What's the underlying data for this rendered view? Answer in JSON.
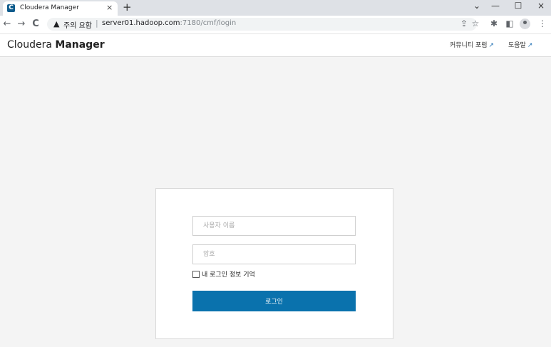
{
  "browser": {
    "tab": {
      "favicon_letter": "C",
      "title": "Cloudera Manager",
      "close_glyph": "×"
    },
    "new_tab_glyph": "+",
    "window_controls": {
      "tab_search": "⌄",
      "minimize": "—",
      "maximize": "☐",
      "close": "×"
    },
    "nav": {
      "back": "←",
      "forward": "→",
      "reload": "C"
    },
    "address": {
      "security_icon": "warning-triangle-icon",
      "security_glyph": "▲",
      "security_text": "주의 요함",
      "separator": "|",
      "url_host": "server01.hadoop.com",
      "url_path": ":7180/cmf/login"
    },
    "toolbar": {
      "share": "⇪",
      "bookmark": "☆",
      "extensions": "✱",
      "sidepanel": "◧",
      "menu": "⋮"
    }
  },
  "header": {
    "brand_light": "Cloudera ",
    "brand_bold": "Manager",
    "links": [
      {
        "label": "커뮤니티 포럼",
        "icon": "external-link-icon",
        "glyph": "↗"
      },
      {
        "label": "도움말",
        "icon": "external-link-icon",
        "glyph": "↗"
      }
    ]
  },
  "login": {
    "username_placeholder": "사용자 이름",
    "password_placeholder": "암호",
    "remember_label": "내 로그인 정보 기억",
    "remember_checked": false,
    "submit_label": "로그인"
  },
  "colors": {
    "accent": "#0a72ad",
    "page_bg": "#f4f4f4",
    "tabstrip_bg": "#dee1e6"
  }
}
